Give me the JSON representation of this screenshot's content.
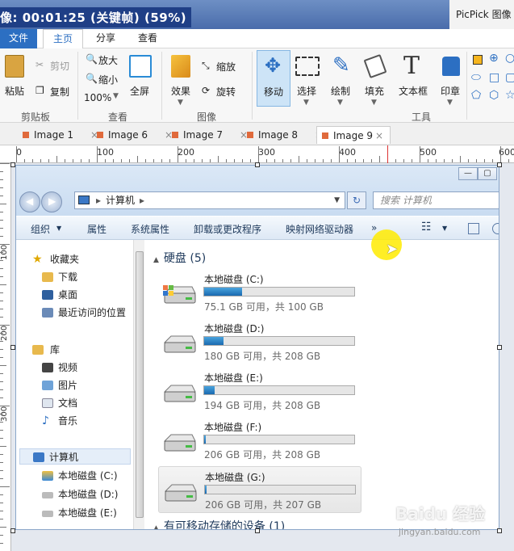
{
  "titlebar": {
    "recording": "像: 00:01:25 (关键帧) (59%)",
    "app_title": "PicPick 图像编"
  },
  "menu": {
    "file": "文件",
    "home": "主页",
    "share": "分享",
    "view": "查看"
  },
  "ribbon": {
    "paste": "粘贴",
    "cut": "剪切",
    "copy": "复制",
    "clipboard_group": "剪贴板",
    "zoom_in": "放大",
    "zoom_out": "缩小",
    "zoom_level": "100%",
    "fullscreen": "全屏",
    "view_group": "查看",
    "effects": "效果",
    "resize": "缩放",
    "rotate": "旋转",
    "image_group": "图像",
    "move": "移动",
    "select": "选择",
    "draw": "绘制",
    "fill": "填充",
    "text": "文本框",
    "stamp": "印章",
    "tools_group": "工具"
  },
  "tabs": [
    "Image 1",
    "Image 6",
    "Image 7",
    "Image 8",
    "Image 9"
  ],
  "ruler": {
    "h": [
      "0",
      "100",
      "200",
      "300",
      "400",
      "500",
      "600"
    ],
    "v": [
      "100",
      "200",
      "300"
    ]
  },
  "explorer": {
    "address": "计算机",
    "search_placeholder": "搜索 计算机",
    "commands": [
      "组织",
      "属性",
      "系统属性",
      "卸载或更改程序",
      "映射网络驱动器",
      "»"
    ],
    "nav": {
      "favorites": "收藏夹",
      "downloads": "下载",
      "desktop": "桌面",
      "recent": "最近访问的位置",
      "library": "库",
      "videos": "视频",
      "pictures": "图片",
      "documents": "文档",
      "music": "音乐",
      "computer": "计算机",
      "drive_c": "本地磁盘 (C:)",
      "drive_d": "本地磁盘 (D:)",
      "drive_e": "本地磁盘 (E:)"
    },
    "hdd_header": "硬盘 (5)",
    "removable_header": "有可移动存储的设备 (1)",
    "drives": [
      {
        "name": "本地磁盘 (C:)",
        "size": "75.1 GB 可用，共 100 GB",
        "used_frac": 0.25
      },
      {
        "name": "本地磁盘 (D:)",
        "size": "180 GB 可用，共 208 GB",
        "used_frac": 0.13
      },
      {
        "name": "本地磁盘 (E:)",
        "size": "194 GB 可用，共 208 GB",
        "used_frac": 0.07
      },
      {
        "name": "本地磁盘 (F:)",
        "size": "206 GB 可用，共 208 GB",
        "used_frac": 0.01
      },
      {
        "name": "本地磁盘 (G:)",
        "size": "206 GB 可用，共 207 GB",
        "used_frac": 0.005
      }
    ]
  },
  "watermark": {
    "logo": "Baidu 经验",
    "url": "jingyan.baidu.com"
  },
  "colors": {
    "accent": "#2c6fc2",
    "tab_marker": "#e06a3c",
    "disk_fill": "#1a6ab0"
  }
}
